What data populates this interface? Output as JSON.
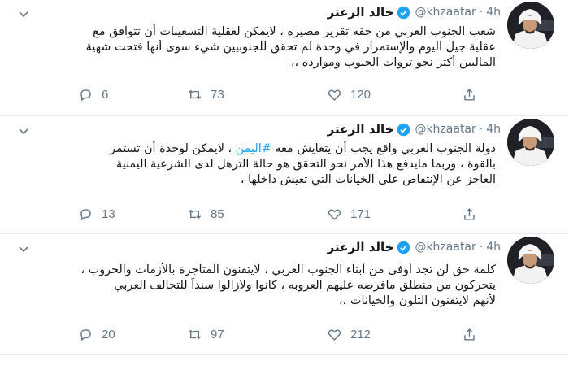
{
  "tweets": [
    {
      "name": "خالد الزعتر",
      "handle": "@khzaatar",
      "dot": "·",
      "time": "4h",
      "lines": [
        "شعب الجنوب العربي من حقه تقرير مصيره ، لايمكن لعقلية التسعينات أن تتوافق مع",
        "عقلية جيل اليوم والإستمرار في وحدة لم تحقق للجنوبيين شيء سوى أنها فتحت شهية",
        "الماليين أكثر نحو ثروات الجنوب وموارده ،،"
      ],
      "replies": "6",
      "retweets": "73",
      "likes": "120"
    },
    {
      "name": "خالد الزعتر",
      "handle": "@khzaatar",
      "dot": "·",
      "time": "4h",
      "line1_before": "دولة الجنوب العربي واقع يجب أن يتعايش معه ",
      "hashtag": "#اليمن",
      "line1_after": " ، لايمكن لوحدة أن تستمر",
      "lines": [
        "بالقوة ، وربما مايدفع هذا الأمر نحو التحقق هو حالة الترهل لدى الشرعية اليمنية",
        "العاجز عن الإنتفاض على الخيانات التي تعيش داخلها ،"
      ],
      "replies": "13",
      "retweets": "85",
      "likes": "171"
    },
    {
      "name": "خالد الزعتر",
      "handle": "@khzaatar",
      "dot": "·",
      "time": "4h",
      "lines": [
        "كلمة حق لن تجد أوفى من أبناء الجنوب العربي ، لايتقنون المتاجرة بالأزمات والحروب ،",
        "يتحركون من منطلق مافرضه عليهم العروبه ، كانوا ولازالوا سنداً للتحالف العربي",
        "لأنهم لايتقنون التلون والخيانات ،،"
      ],
      "replies": "20",
      "retweets": "97",
      "likes": "212"
    }
  ],
  "colors": {
    "accent": "#1da1f2",
    "muted": "#657786",
    "text": "#14171a",
    "border": "#e6ecf0"
  },
  "icons": [
    "chevron-down-icon",
    "verified-badge-icon",
    "reply-icon",
    "retweet-icon",
    "like-icon",
    "share-icon"
  ]
}
